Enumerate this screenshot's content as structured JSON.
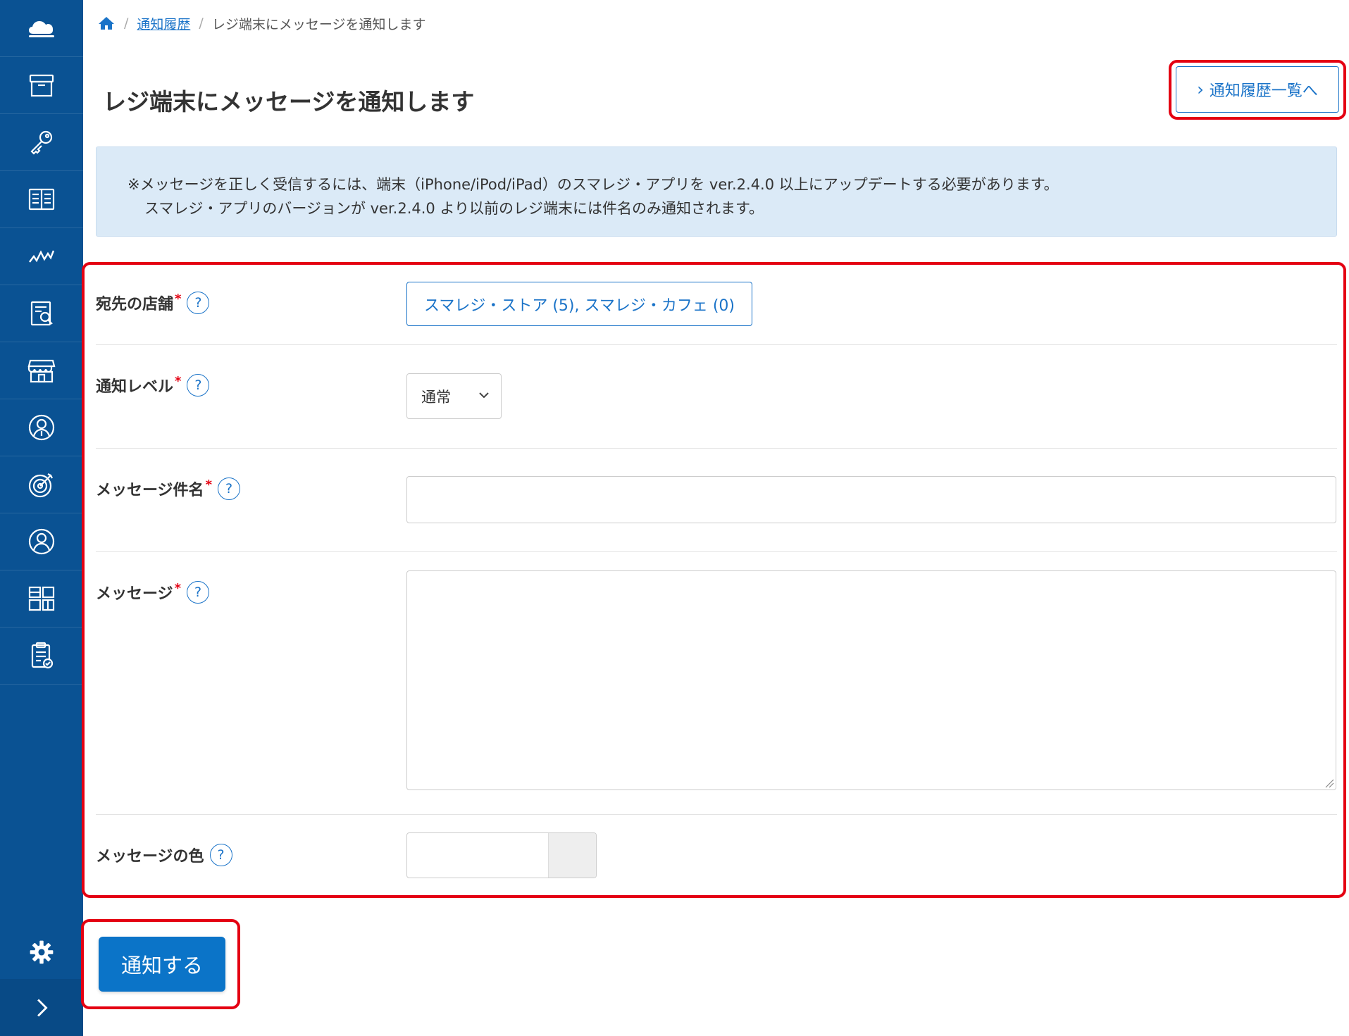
{
  "breadcrumb": {
    "items": [
      "通知履歴",
      "レジ端末にメッセージを通知します"
    ],
    "separator": "/"
  },
  "page": {
    "title": "レジ端末にメッセージを通知します"
  },
  "header": {
    "list_button_label": "通知履歴一覧へ",
    "list_button_chevron": "›"
  },
  "notice": {
    "line1": "※メッセージを正しく受信するには、端末（iPhone/iPod/iPad）のスマレジ・アプリを ver.2.4.0 以上にアップデートする必要があります。",
    "line2": "スマレジ・アプリのバージョンが ver.2.4.0 より以前のレジ端末には件名のみ通知されます。"
  },
  "form": {
    "required_mark": "*",
    "help_mark": "?",
    "store": {
      "label": "宛先の店舗",
      "value": "スマレジ・ストア (5), スマレジ・カフェ (0)"
    },
    "level": {
      "label": "通知レベル",
      "selected": "通常"
    },
    "subject": {
      "label": "メッセージ件名",
      "value": ""
    },
    "message": {
      "label": "メッセージ",
      "value": ""
    },
    "color": {
      "label": "メッセージの色",
      "value": ""
    }
  },
  "actions": {
    "submit_label": "通知する"
  },
  "sidebar": {
    "icons": [
      "cloud-icon",
      "archive-icon",
      "key-icon",
      "book-icon",
      "chart-line-icon",
      "report-icon",
      "store-icon",
      "customer-icon",
      "target-icon",
      "user-icon",
      "layout-icon",
      "clipboard-icon"
    ],
    "settings_icon": "gear-icon",
    "expand_icon": "chevron-right-icon"
  },
  "colors": {
    "sidebar": "#0a5293",
    "accent": "#1a73c8",
    "primary_button": "#0b74c8",
    "highlight_frame": "#e40012",
    "notice_bg": "#dbeaf7"
  }
}
